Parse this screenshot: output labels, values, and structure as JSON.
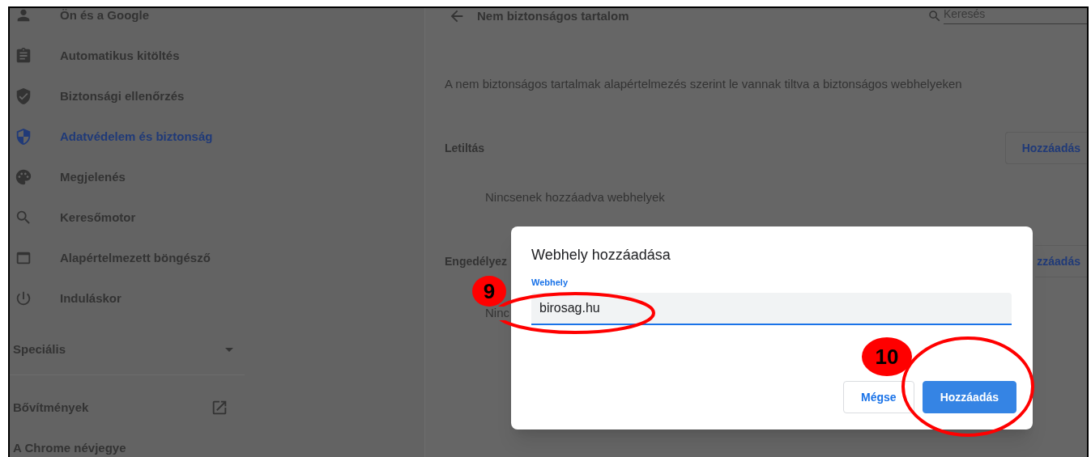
{
  "sidebar": {
    "items": [
      {
        "label": "Ön és a Google",
        "selected": false
      },
      {
        "label": "Automatikus kitöltés",
        "selected": false
      },
      {
        "label": "Biztonsági ellenőrzés",
        "selected": false
      },
      {
        "label": "Adatvédelem és biztonság",
        "selected": true
      },
      {
        "label": "Megjelenés",
        "selected": false
      },
      {
        "label": "Keresőmotor",
        "selected": false
      },
      {
        "label": "Alapértelmezett böngésző",
        "selected": false
      },
      {
        "label": "Induláskor",
        "selected": false
      }
    ],
    "advanced": {
      "label": "Speciális",
      "expanded": false
    },
    "links": [
      {
        "label": "Bővítmények",
        "external": true
      },
      {
        "label": "A Chrome névjegye",
        "external": false
      }
    ]
  },
  "main": {
    "title": "Nem biztonságos tartalom",
    "search": {
      "placeholder": "Keresés"
    },
    "description": "A nem biztonságos tartalmak alapértelmezés szerint le vannak tiltva a biztonságos webhelyeken",
    "sections": [
      {
        "heading": "Letiltás",
        "button": "Hozzáadás",
        "empty": "Nincsenek hozzáadva webhelyek"
      },
      {
        "heading": "Engedélyez",
        "button": "zzáadás",
        "empty": "Ninc"
      }
    ]
  },
  "dialog": {
    "title": "Webhely hozzáadása",
    "field_label": "Webhely",
    "value": "birosag.hu",
    "buttons": [
      {
        "label": "Mégse",
        "kind": "secondary"
      },
      {
        "label": "Hozzáadás",
        "kind": "primary"
      }
    ]
  },
  "annotations": [
    {
      "label": "9"
    },
    {
      "label": "10"
    }
  ]
}
